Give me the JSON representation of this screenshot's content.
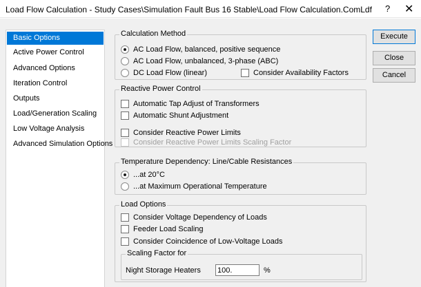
{
  "window": {
    "title": "Load Flow Calculation - Study Cases\\Simulation Fault Bus 16 Stable\\Load Flow Calculation.ComLdf",
    "help_glyph": "?",
    "close_glyph": "✕"
  },
  "sidebar": {
    "items": [
      {
        "label": "Basic Options",
        "selected": true
      },
      {
        "label": "Active Power Control"
      },
      {
        "label": "Advanced Options"
      },
      {
        "label": "Iteration Control"
      },
      {
        "label": "Outputs"
      },
      {
        "label": "Load/Generation Scaling"
      },
      {
        "label": "Low Voltage Analysis"
      },
      {
        "label": "Advanced Simulation Options"
      }
    ]
  },
  "calc_method": {
    "title": "Calculation Method",
    "opt_ac_balanced": "AC Load Flow, balanced, positive sequence",
    "opt_ac_unbalanced": "AC Load Flow, unbalanced, 3-phase (ABC)",
    "opt_dc": "DC Load Flow (linear)",
    "availability": "Consider Availability Factors",
    "selected": "AC Load Flow, balanced, positive sequence"
  },
  "reactive": {
    "title": "Reactive Power Control",
    "tap_adjust": "Automatic Tap Adjust of Transformers",
    "shunt_adjust": "Automatic Shunt Adjustment",
    "reactive_limits": "Consider Reactive Power Limits",
    "reactive_limits_scaling": "Consider Reactive Power Limits Scaling Factor"
  },
  "temperature": {
    "title": "Temperature Dependency: Line/Cable Resistances",
    "opt_20c": "...at 20°C",
    "opt_max": "...at Maximum Operational Temperature",
    "selected": "...at 20°C"
  },
  "load_options": {
    "title": "Load Options",
    "voltage_dependency": "Consider Voltage Dependency of Loads",
    "feeder_scaling": "Feeder Load Scaling",
    "coincidence": "Consider Coincidence of Low-Voltage Loads",
    "scaling_factor_title": "Scaling Factor for",
    "night_storage_label": "Night Storage Heaters",
    "night_storage_value": "100.",
    "night_storage_unit": "%"
  },
  "buttons": {
    "execute": "Execute",
    "close": "Close",
    "cancel": "Cancel"
  },
  "colors": {
    "selection": "#0078d7",
    "panel_bg": "#f0f0f0"
  }
}
